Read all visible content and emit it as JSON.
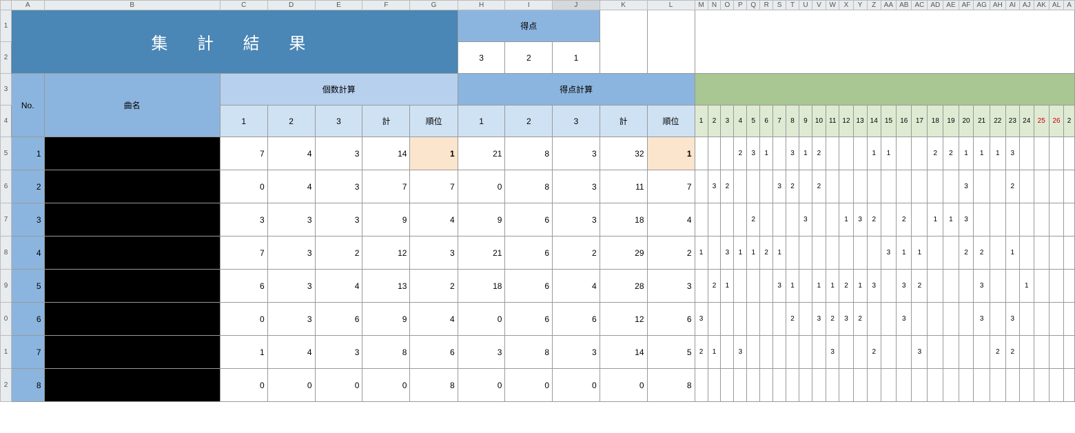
{
  "colletters": [
    "A",
    "B",
    "C",
    "D",
    "E",
    "F",
    "G",
    "H",
    "I",
    "J",
    "K",
    "L",
    "M",
    "N",
    "O",
    "P",
    "Q",
    "R",
    "S",
    "T",
    "U",
    "V",
    "W",
    "X",
    "Y",
    "Z",
    "AA",
    "AB",
    "AC",
    "AD",
    "AE",
    "AF",
    "AG",
    "AH",
    "AI",
    "AJ",
    "AK",
    "AL",
    "A"
  ],
  "rowlabels": [
    "1",
    "2",
    "3",
    "4",
    "5",
    "6",
    "7",
    "8",
    "9",
    "0",
    "1",
    "2"
  ],
  "title": "集  計  結  果",
  "tokuten_hdr": "得点",
  "tokuten_vals": [
    "3",
    "2",
    "1"
  ],
  "kosu_hdr": "個数計算",
  "score_hdr": "得点計算",
  "no_hdr": "No.",
  "name_hdr": "曲名",
  "sub_hdrs": [
    "1",
    "2",
    "3",
    "計",
    "順位"
  ],
  "detail_hdrs": [
    "1",
    "2",
    "3",
    "4",
    "5",
    "6",
    "7",
    "8",
    "9",
    "10",
    "11",
    "12",
    "13",
    "14",
    "15",
    "16",
    "17",
    "18",
    "19",
    "20",
    "21",
    "22",
    "23",
    "24",
    "25",
    "26",
    "2"
  ],
  "red_idx": [
    24,
    25
  ],
  "rows": [
    {
      "no": "1",
      "kosu": [
        "7",
        "4",
        "3",
        "14",
        "1"
      ],
      "score": [
        "21",
        "8",
        "3",
        "32",
        "1"
      ],
      "hl": true,
      "d": [
        "",
        "",
        "",
        "2",
        "3",
        "1",
        "",
        "3",
        "1",
        "2",
        "",
        "",
        "",
        "1",
        "1",
        "",
        "",
        "2",
        "2",
        "1",
        "1",
        "1",
        "3",
        "",
        "",
        "",
        ""
      ]
    },
    {
      "no": "2",
      "kosu": [
        "0",
        "4",
        "3",
        "7",
        "7"
      ],
      "score": [
        "0",
        "8",
        "3",
        "11",
        "7"
      ],
      "d": [
        "",
        "3",
        "2",
        "",
        "",
        "",
        "3",
        "2",
        "",
        "2",
        "",
        "",
        "",
        "",
        "",
        "",
        "",
        "",
        "",
        "3",
        "",
        "",
        "2",
        "",
        "",
        "",
        ""
      ]
    },
    {
      "no": "3",
      "kosu": [
        "3",
        "3",
        "3",
        "9",
        "4"
      ],
      "score": [
        "9",
        "6",
        "3",
        "18",
        "4"
      ],
      "d": [
        "",
        "",
        "",
        "",
        "2",
        "",
        "",
        "",
        "3",
        "",
        "",
        "1",
        "3",
        "2",
        "",
        "2",
        "",
        "1",
        "1",
        "3",
        "",
        "",
        "",
        "",
        "",
        "",
        ""
      ]
    },
    {
      "no": "4",
      "kosu": [
        "7",
        "3",
        "2",
        "12",
        "3"
      ],
      "score": [
        "21",
        "6",
        "2",
        "29",
        "2"
      ],
      "d": [
        "1",
        "",
        "3",
        "1",
        "1",
        "2",
        "1",
        "",
        "",
        "",
        "",
        "",
        "",
        "",
        "3",
        "1",
        "1",
        "",
        "",
        "2",
        "2",
        "",
        "1",
        "",
        "",
        "",
        ""
      ]
    },
    {
      "no": "5",
      "kosu": [
        "6",
        "3",
        "4",
        "13",
        "2"
      ],
      "score": [
        "18",
        "6",
        "4",
        "28",
        "3"
      ],
      "d": [
        "",
        "2",
        "1",
        "",
        "",
        "",
        "3",
        "1",
        "",
        "1",
        "1",
        "2",
        "1",
        "3",
        "",
        "3",
        "2",
        "",
        "",
        "",
        "3",
        "",
        "",
        "1",
        "",
        "",
        ""
      ]
    },
    {
      "no": "6",
      "kosu": [
        "0",
        "3",
        "6",
        "9",
        "4"
      ],
      "score": [
        "0",
        "6",
        "6",
        "12",
        "6"
      ],
      "d": [
        "3",
        "",
        "",
        "",
        "",
        "",
        "",
        "2",
        "",
        "3",
        "2",
        "3",
        "2",
        "",
        "",
        "3",
        "",
        "",
        "",
        "",
        "3",
        "",
        "3",
        "",
        "",
        "",
        ""
      ]
    },
    {
      "no": "7",
      "kosu": [
        "1",
        "4",
        "3",
        "8",
        "6"
      ],
      "score": [
        "3",
        "8",
        "3",
        "14",
        "5"
      ],
      "d": [
        "2",
        "1",
        "",
        "3",
        "",
        "",
        "",
        "",
        "",
        "",
        "3",
        "",
        "",
        "2",
        "",
        "",
        "3",
        "",
        "",
        "",
        "",
        "2",
        "2",
        "",
        "",
        "",
        ""
      ]
    },
    {
      "no": "8",
      "kosu": [
        "0",
        "0",
        "0",
        "0",
        "8"
      ],
      "score": [
        "0",
        "0",
        "0",
        "0",
        "8"
      ],
      "d": [
        "",
        "",
        "",
        "",
        "",
        "",
        "",
        "",
        "",
        "",
        "",
        "",
        "",
        "",
        "",
        "",
        "",
        "",
        "",
        "",
        "",
        "",
        "",
        "",
        "",
        "",
        ""
      ]
    }
  ]
}
